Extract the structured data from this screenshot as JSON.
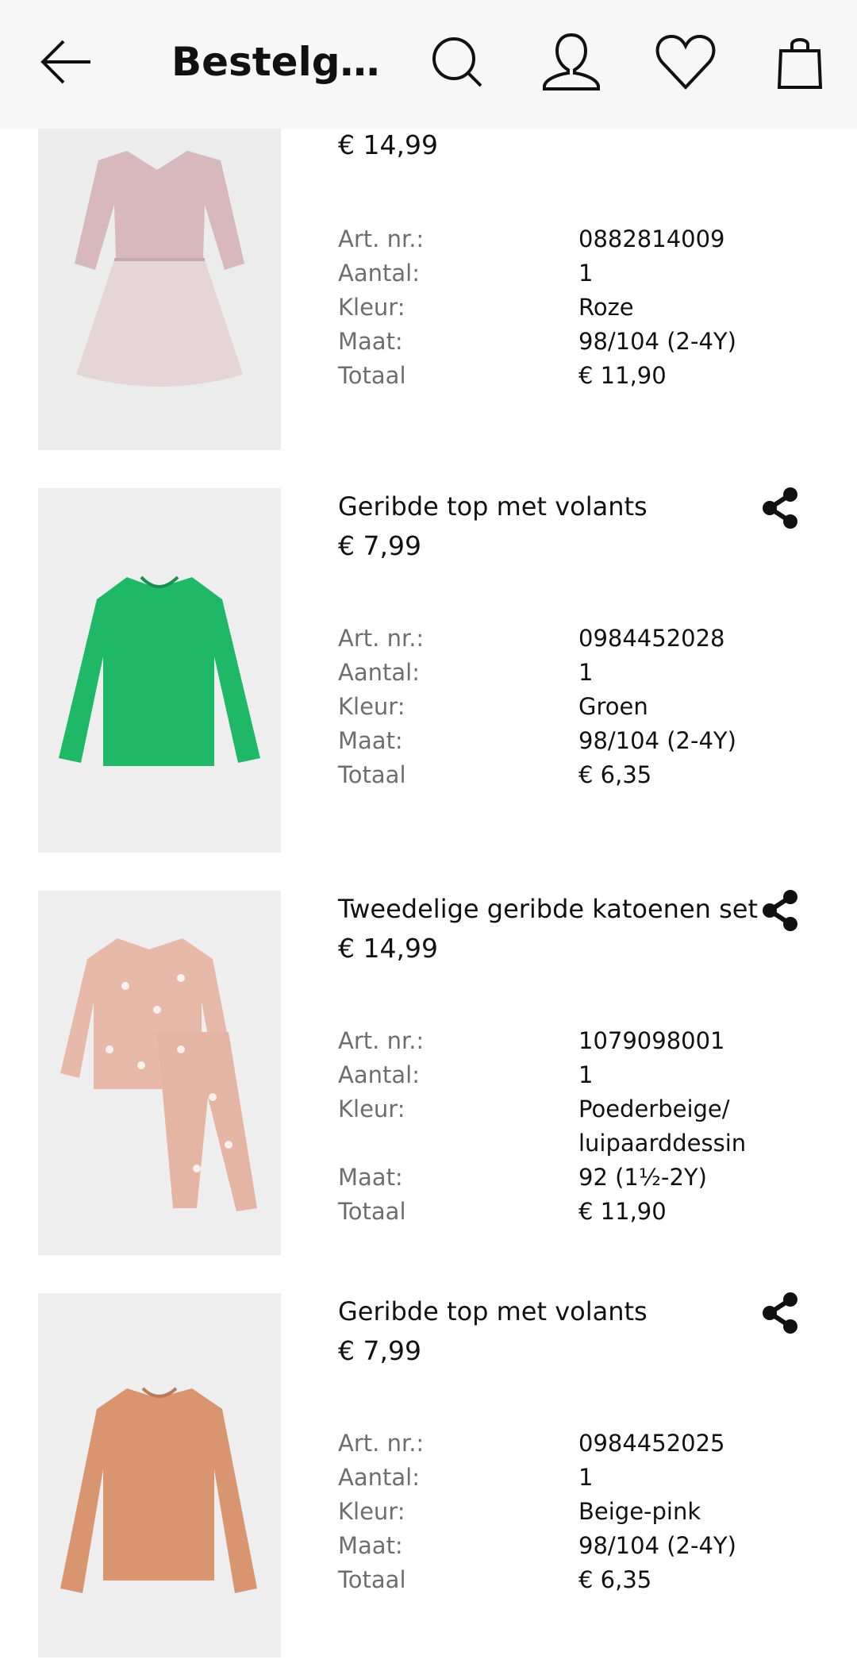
{
  "header": {
    "title": "Bestelgeg...",
    "icons": [
      "back-arrow-icon",
      "search-icon",
      "account-icon",
      "heart-icon",
      "shopping-bag-icon"
    ]
  },
  "labels": {
    "art": "Art. nr.:",
    "qty": "Aantal:",
    "color": "Kleur:",
    "size": "Maat:",
    "total": "Totaal"
  },
  "items": [
    {
      "name": "",
      "price": "€ 14,99",
      "art": "0882814009",
      "qty": "1",
      "color": "Roze",
      "size": "98/104 (2-4Y)",
      "total": "€ 11,90"
    },
    {
      "name": "Geribde top met volants",
      "price": "€ 7,99",
      "art": "0984452028",
      "qty": "1",
      "color": "Groen",
      "size": "98/104 (2-4Y)",
      "total": "€ 6,35"
    },
    {
      "name": "Tweedelige geribde katoenen set",
      "price": "€ 14,99",
      "art": "1079098001",
      "qty": "1",
      "color": "Poederbeige/ luipaarddessin",
      "size": "92 (1½-2Y)",
      "total": "€ 11,90"
    },
    {
      "name": "Geribde top met volants",
      "price": "€ 7,99",
      "art": "0984452025",
      "qty": "1",
      "color": "Beige-pink",
      "size": "98/104 (2-4Y)",
      "total": "€ 6,35"
    }
  ]
}
